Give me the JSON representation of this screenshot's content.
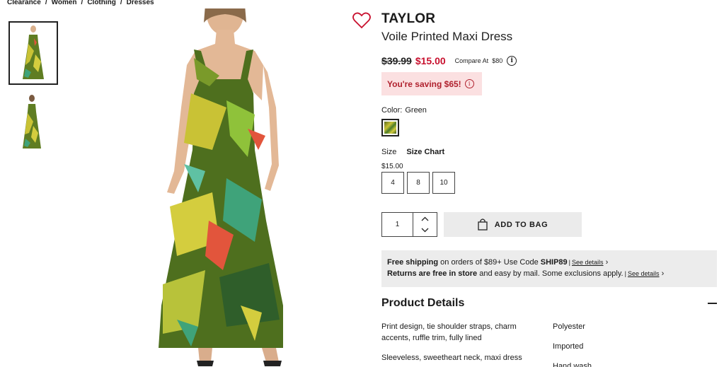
{
  "breadcrumb": [
    "Clearance",
    "Women",
    "Clothing",
    "Dresses"
  ],
  "product": {
    "brand": "TAYLOR",
    "name": "Voile Printed Maxi Dress",
    "old_price": "$39.99",
    "new_price": "$15.00",
    "compare_label": "Compare At",
    "compare_value": "$80",
    "saving": "You're saving $65!"
  },
  "color": {
    "label": "Color:",
    "value": "Green"
  },
  "size": {
    "label": "Size",
    "chart_link": "Size Chart",
    "price": "$15.00",
    "options": [
      "4",
      "8",
      "10"
    ]
  },
  "quantity": "1",
  "add_to_bag": "ADD TO BAG",
  "shipping": {
    "line1_bold": "Free shipping",
    "line1_text": " on orders of $89+ Use Code ",
    "line1_code": "SHIP89",
    "line1_link": "See details",
    "line2_bold": "Returns are free in store",
    "line2_text": " and easy by mail. Some exclusions apply.",
    "line2_link": "See details"
  },
  "details": {
    "title": "Product Details",
    "left": [
      "Print design, tie shoulder straps, charm accents, ruffle trim, fully lined",
      "Sleeveless, sweetheart neck, maxi dress"
    ],
    "right": [
      "Polyester",
      "Imported",
      "Hand wash"
    ]
  },
  "colors": {
    "sale": "#c8102e",
    "saving_bg": "#fbe0e1",
    "button_bg": "#ebebeb",
    "info_bg": "#ececec"
  }
}
